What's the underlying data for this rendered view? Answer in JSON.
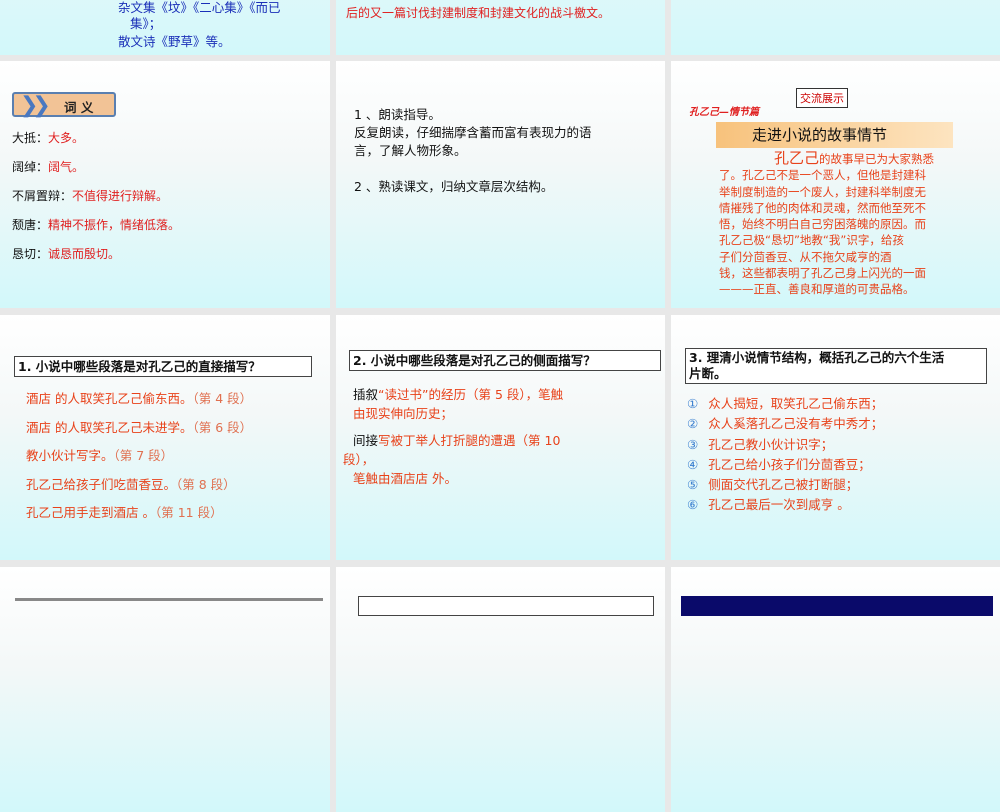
{
  "slides": {
    "s1": {
      "lines": [
        "杂文集《坟》《二心集》《而已",
        "集》；",
        "散文诗《野草》等。"
      ]
    },
    "s2": {
      "lines": [
        "后的又一篇讨伐封建制度和封建文化的战斗檄文。"
      ]
    },
    "s4": {
      "header": "词 义",
      "items": [
        {
          "term": "大抵：",
          "def": "大多。"
        },
        {
          "term": "阔绰：",
          "def": "阔气。"
        },
        {
          "term": "不屑置辩：",
          "def": "不值得进行辩解。"
        },
        {
          "term": "颓唐：",
          "def": "精神不振作，情绪低落。"
        },
        {
          "term": "恳切：",
          "def": "诚恳而殷切。"
        }
      ]
    },
    "s5": {
      "lines": [
        "1 、朗读指导。",
        "反复朗读，仔细揣摩含蓄而富有表现力的语",
        "言，了解人物形象。",
        "2 、熟读课文，归纳文章层次结构。"
      ]
    },
    "s6": {
      "badge": "交流展示",
      "subtitle": "孔乙己—情节篇",
      "title": "走进小说的故事情节",
      "lead": "孔乙己",
      "lines": [
        "的故事早已为大家熟悉",
        "了。孔乙己不是一个恶人，但他是封建科",
        "举制度制造的一个废人，封建科举制度无",
        "情摧残了他的肉体和灵魂，然而他至死不",
        "悟，始终不明白自己穷困落魄的原因。而",
        "孔乙己极“恳切”地教“我”识字，给孩",
        "子们分茴香豆、从不拖欠咸亨的酒",
        "钱，这些都表明了孔乙己身上闪光的一面",
        "———正直、善良和厚道的可贵品格。"
      ]
    },
    "s7": {
      "question": "1. 小说中哪些段落是对孔乙己的直接描写？",
      "items": [
        {
          "text": "酒店  的人取笑孔乙己偷东西。",
          "ref": "（第 4 段）"
        },
        {
          "text": "酒店  的人取笑孔乙己未进学。",
          "ref": "（第 6 段）"
        },
        {
          "text": "教小伙计写字。",
          "ref": "（第 7 段）"
        },
        {
          "text": "孔乙己给孩子们吃茴香豆。",
          "ref": "（第 8 段）"
        },
        {
          "text": "孔乙己用手走到酒店    。",
          "ref": "（第 11 段）"
        }
      ]
    },
    "s8": {
      "question": "2. 小说中哪些段落是对孔乙己的侧面描写？",
      "p1_lead": "插叙",
      "p1_lines": [
        "“读过书”的经历（第 5 段），笔触",
        "由现实伸向历史；"
      ],
      "p2_lead": "间接",
      "p2_lines": [
        "写被丁举人打折腿的遭遇（第 10",
        "段），",
        "笔触由酒店店    外。"
      ]
    },
    "s9": {
      "question_lines": [
        "3. 理清小说情节结构，概括孔乙己的六个生活",
        "片断。"
      ],
      "items": [
        {
          "num": "①",
          "text": "众人揭短，取笑孔乙己偷东西；"
        },
        {
          "num": "②",
          "text": "众人奚落孔乙己没有考中秀才；"
        },
        {
          "num": "③",
          "text": "孔乙己教小伙计识字；"
        },
        {
          "num": "④",
          "text": "孔乙己给小孩子们分茴香豆；"
        },
        {
          "num": "⑤",
          "text": "侧面交代孔乙己被打断腿；"
        },
        {
          "num": "⑥",
          "text": "孔乙己最后一次到咸亨    。"
        }
      ]
    }
  }
}
